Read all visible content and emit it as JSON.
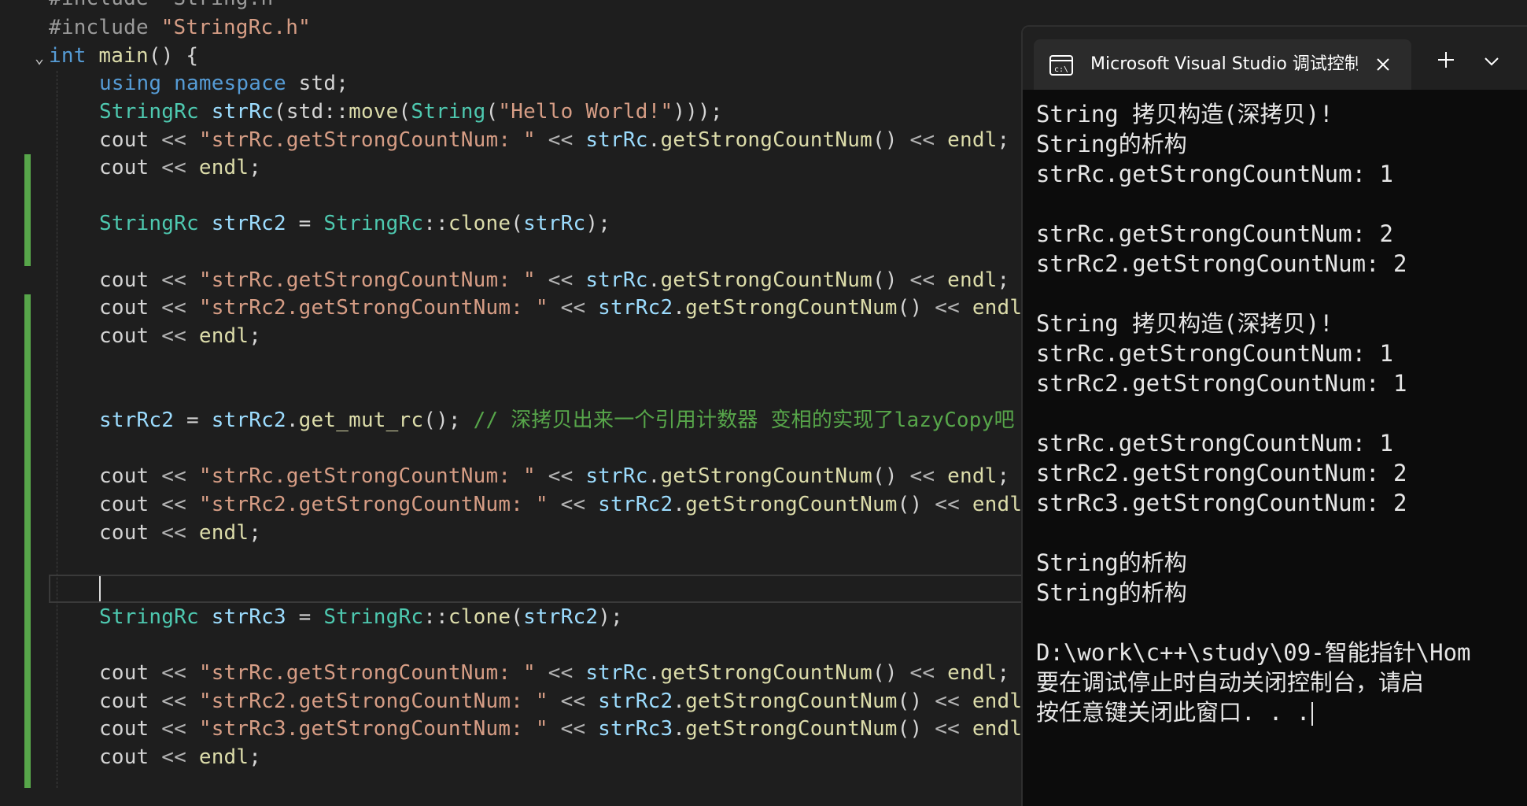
{
  "editor": {
    "line_0": "#include \"String.h\"",
    "line_1_pp": "#include ",
    "line_1_str": "\"StringRc.h\"",
    "kw_int": "int",
    "fn_main": "main",
    "paren_open": "() {",
    "kw_using": "using",
    "kw_namespace": "namespace",
    "std_semi": " std;",
    "StringRc": "StringRc",
    "strRc": "strRc",
    "strRc2": "strRc2",
    "strRc3": "strRc3",
    "std_scope": "std::",
    "move": "move",
    "String": "String",
    "hello": "\"Hello World!\"",
    "close3": ")));",
    "cout": "cout",
    "lshift": " << ",
    "s_strRc": "\"strRc.getStrongCountNum: \"",
    "s_strRc2": "\"strRc2.getStrongCountNum: \"",
    "s_strRc3": "\"strRc3.getStrongCountNum: \"",
    "dot": ".",
    "getStrong": "getStrongCountNum",
    "call_parens": "()",
    "endl": "endl",
    "semi": ";",
    "assign": " = ",
    "scope": "::",
    "clone": "clone",
    "get_mut_rc": "get_mut_rc",
    "call_semi": "(); ",
    "comment": "// 深拷贝出来一个引用计数器 变相的实现了lazyCopy吧 手动的",
    "open_paren": "(",
    "close_semi": ");",
    "paren_open_only": "(",
    "space": " "
  },
  "console": {
    "tab_title": "Microsoft Visual Studio 调试控制台",
    "lines": [
      "String 拷贝构造(深拷贝)!",
      "String的析构",
      "strRc.getStrongCountNum: 1",
      "",
      "strRc.getStrongCountNum: 2",
      "strRc2.getStrongCountNum: 2",
      "",
      "String 拷贝构造(深拷贝)!",
      "strRc.getStrongCountNum: 1",
      "strRc2.getStrongCountNum: 1",
      "",
      "strRc.getStrongCountNum: 1",
      "strRc2.getStrongCountNum: 2",
      "strRc3.getStrongCountNum: 2",
      "",
      "String的析构",
      "String的析构",
      "",
      "D:\\work\\c++\\study\\09-智能指针\\Hom",
      "要在调试停止时自动关闭控制台，请启",
      "按任意键关闭此窗口. . ."
    ]
  },
  "icons": {
    "terminal": "terminal-icon",
    "close": "close-icon",
    "add": "plus-icon",
    "dropdown": "chevron-down-icon"
  },
  "colors": {
    "keyword": "#569cd6",
    "type": "#4ec9b0",
    "function": "#dcdcaa",
    "variable": "#9cdcfe",
    "string": "#d69d85",
    "comment": "#57a64a",
    "gutter_change": "#57a64a"
  }
}
